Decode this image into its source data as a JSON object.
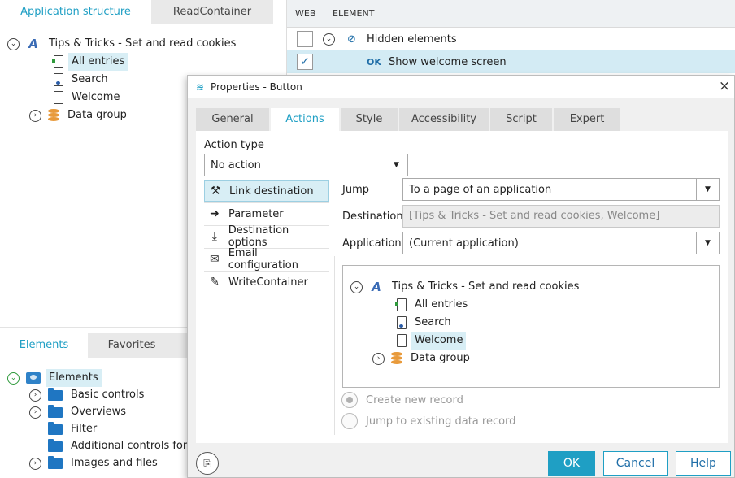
{
  "left_top_tabs": {
    "active": "Application structure",
    "inactive": "ReadContainer"
  },
  "left_tree": {
    "root": "Tips & Tricks - Set and read cookies",
    "items": [
      "All entries",
      "Search",
      "Welcome",
      "Data group"
    ]
  },
  "left_bottom_tabs": {
    "active": "Elements",
    "inactive": "Favorites"
  },
  "elements_tree": {
    "root": "Elements",
    "items": [
      "Basic controls",
      "Overviews",
      "Filter",
      "Additional controls for c",
      "Images and files"
    ]
  },
  "grid": {
    "col_web": "WEB",
    "col_element": "ELEMENT",
    "rows": [
      {
        "label": "Hidden elements",
        "checked": false,
        "badge": ""
      },
      {
        "label": "Show welcome screen",
        "checked": true,
        "badge": "OK"
      }
    ]
  },
  "dialog": {
    "title": "Properties - Button",
    "close": "×",
    "tabs": [
      "General",
      "Actions",
      "Style",
      "Accessibility",
      "Script",
      "Expert"
    ],
    "action_type_label": "Action type",
    "action_type_value": "No action",
    "actions": [
      "Link destination",
      "Parameter",
      "Destination options",
      "Email configuration",
      "WriteContainer"
    ],
    "jump_label": "Jump",
    "jump_value": "To a page of an application",
    "destination_label": "Destination",
    "destination_value": "[Tips & Tricks - Set and read cookies, Welcome]",
    "application_label": "Application",
    "application_value": "(Current application)",
    "tree": {
      "root": "Tips & Tricks - Set and read cookies",
      "items": [
        "All entries",
        "Search",
        "Welcome",
        "Data group"
      ]
    },
    "radio_create": "Create new record",
    "radio_jump": "Jump to existing data record",
    "ok": "OK",
    "cancel": "Cancel",
    "help": "Help"
  },
  "icons": {
    "app": "application-icon",
    "page": "page-icon",
    "database": "database-icon",
    "folder": "folder-icon"
  },
  "colors": {
    "accent": "#1f9fc4",
    "selection": "#d8eef5"
  }
}
